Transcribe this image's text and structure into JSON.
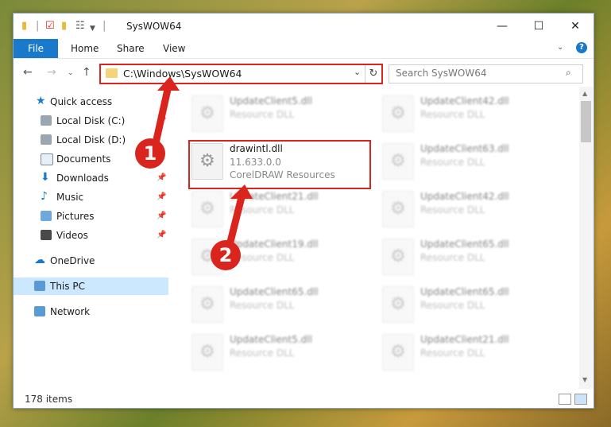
{
  "window": {
    "title": "SysWOW64",
    "controls": {
      "minimize": "—",
      "maximize": "☐",
      "close": "✕"
    }
  },
  "ribbon": {
    "tabs": [
      "File",
      "Home",
      "Share",
      "View"
    ],
    "help": "?"
  },
  "address_bar": {
    "path": "C:\\Windows\\SysWOW64",
    "dropdown": "⌄",
    "refresh": "↻"
  },
  "search": {
    "placeholder": "Search SysWOW64"
  },
  "sidebar": {
    "items": [
      {
        "label": "Quick access",
        "icon": "star-icon"
      },
      {
        "label": "Local Disk (C:)",
        "icon": "drive-icon"
      },
      {
        "label": "Local Disk (D:)",
        "icon": "drive-icon"
      },
      {
        "label": "Documents",
        "icon": "documents-icon"
      },
      {
        "label": "Downloads",
        "icon": "download-icon"
      },
      {
        "label": "Music",
        "icon": "music-icon"
      },
      {
        "label": "Pictures",
        "icon": "pictures-icon"
      },
      {
        "label": "Videos",
        "icon": "videos-icon"
      },
      {
        "label": "OneDrive",
        "icon": "cloud-icon"
      },
      {
        "label": "This PC",
        "icon": "computer-icon"
      },
      {
        "label": "Network",
        "icon": "network-icon"
      }
    ]
  },
  "files": {
    "left": [
      {
        "name": "UpdateClient5.dll",
        "type": "Resource DLL"
      },
      {
        "name": "drawintl.dll",
        "version": "11.633.0.0",
        "type": "CorelDRAW Resources"
      },
      {
        "name": "UpdateClient21.dll",
        "type": "Resource DLL"
      },
      {
        "name": "UpdateClient19.dll",
        "type": "Resource DLL"
      },
      {
        "name": "UpdateClient65.dll",
        "type": "Resource DLL"
      },
      {
        "name": "UpdateClient5.dll",
        "type": "Resource DLL"
      }
    ],
    "right": [
      {
        "name": "UpdateClient42.dll",
        "type": "Resource DLL"
      },
      {
        "name": "UpdateClient63.dll",
        "type": "Resource DLL"
      },
      {
        "name": "UpdateClient42.dll",
        "type": "Resource DLL"
      },
      {
        "name": "UpdateClient65.dll",
        "type": "Resource DLL"
      },
      {
        "name": "UpdateClient65.dll",
        "type": "Resource DLL"
      },
      {
        "name": "UpdateClient21.dll",
        "type": "Resource DLL"
      }
    ]
  },
  "status": {
    "item_count": "178 items"
  },
  "annotations": {
    "marker1": "1",
    "marker2": "2"
  },
  "colors": {
    "accent": "#1979ca",
    "highlight": "#d9251d",
    "selected": "#cce8ff"
  }
}
